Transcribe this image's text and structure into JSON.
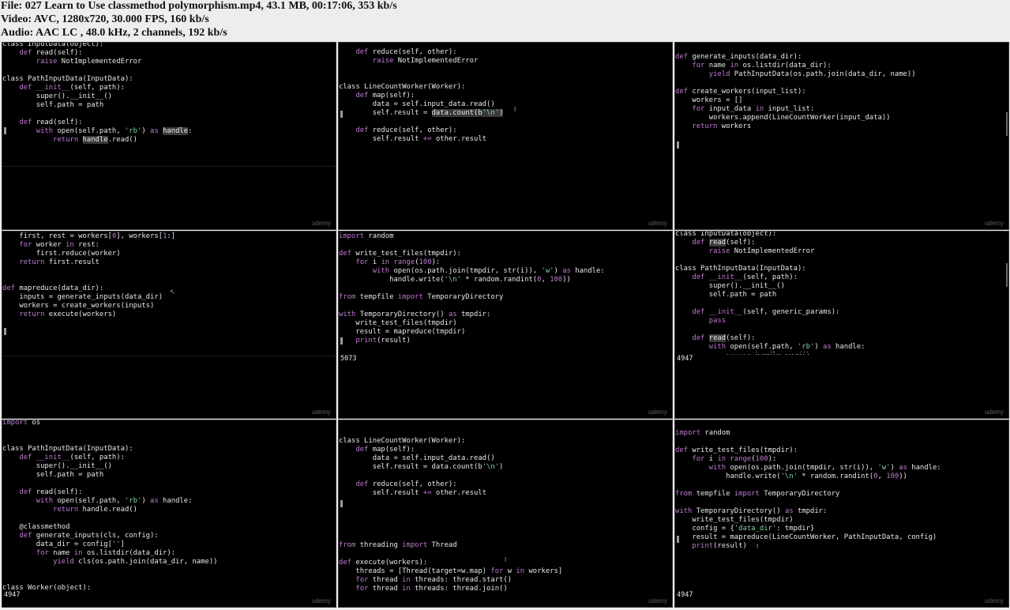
{
  "header": {
    "line1": "File: 027 Learn to Use classmethod polymorphism.mp4, 43.1 MB, 00:17:06, 353 kb/s",
    "line2": "Video: AVC, 1280x720, 30.000 FPS, 160 kb/s",
    "line3": "Audio: AAC LC , 48.0 kHz, 2 channels, 192 kb/s"
  },
  "watermark": "udemy",
  "tiles": [
    {
      "output": ""
    },
    {
      "output": ""
    },
    {
      "output": ""
    },
    {
      "output": ""
    },
    {
      "output": "5073"
    },
    {
      "output": "4947"
    },
    {
      "output": "4947"
    },
    {
      "output": ""
    },
    {
      "output": "4947"
    }
  ]
}
